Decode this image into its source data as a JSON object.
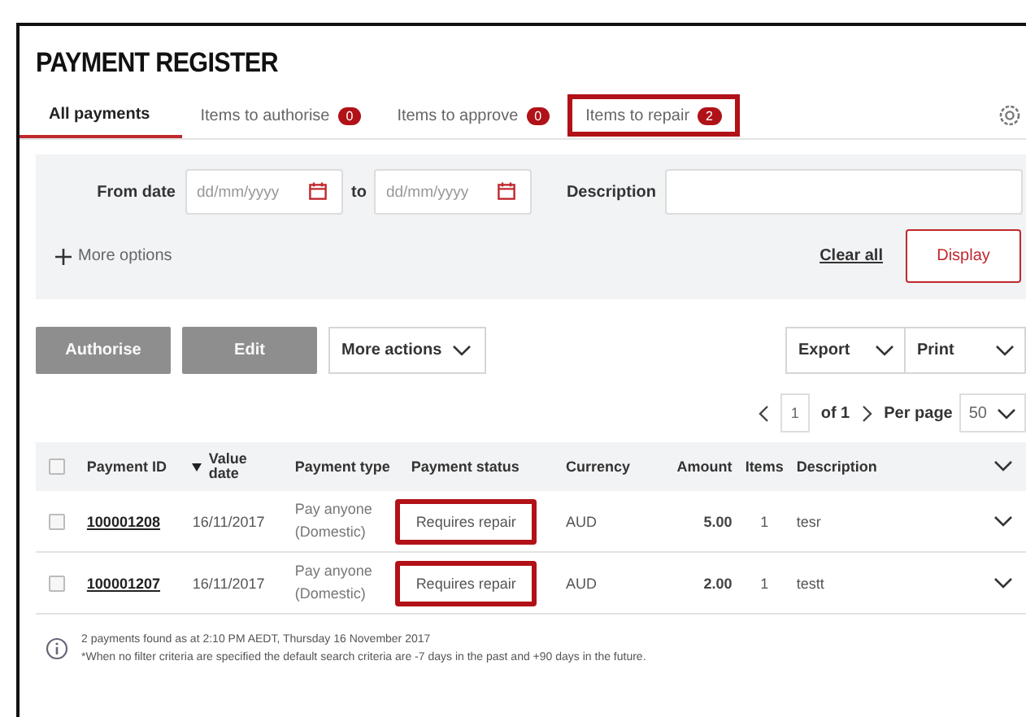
{
  "title": "PAYMENT REGISTER",
  "tabs": [
    {
      "label": "All payments",
      "selected": true,
      "highlighted": false
    },
    {
      "label": "Items to authorise",
      "count": "0",
      "selected": false,
      "highlighted": false
    },
    {
      "label": "Items to approve",
      "count": "0",
      "selected": false,
      "highlighted": false
    },
    {
      "label": "Items to repair",
      "count": "2",
      "selected": false,
      "highlighted": true
    }
  ],
  "filters": {
    "from_label": "From date",
    "from_placeholder": "dd/mm/yyyy",
    "to_label": "to",
    "to_placeholder": "dd/mm/yyyy",
    "description_label": "Description",
    "more_options": "More options",
    "clear_all": "Clear all",
    "display": "Display"
  },
  "actions": [
    {
      "kind": "button",
      "label": "Authorise",
      "disabled": true
    },
    {
      "kind": "button",
      "label": "Edit",
      "disabled": true
    },
    {
      "kind": "menu",
      "label": "More actions"
    }
  ],
  "outputs": [
    {
      "label": "Export"
    },
    {
      "label": "Print"
    }
  ],
  "pagination": {
    "page": "1",
    "of": "of 1",
    "per_page_label": "Per page",
    "per_page": "50"
  },
  "table": {
    "select_all_checked": false,
    "columns": [
      {
        "label": "Payment ID",
        "sorted": false
      },
      {
        "label": "Value date",
        "sorted": true
      },
      {
        "label": "Payment type",
        "sorted": false
      },
      {
        "label": "Payment status",
        "sorted": false
      },
      {
        "label": "Currency",
        "sorted": false
      },
      {
        "label": "Amount",
        "sorted": false
      },
      {
        "label": "Items",
        "sorted": false
      },
      {
        "label": "Description",
        "sorted": false
      }
    ],
    "rows": [
      {
        "checked": false,
        "payment_id": "100001208",
        "value_date": "16/11/2017",
        "payment_type": "Pay anyone (Domestic)",
        "status": "Requires repair",
        "status_highlighted": true,
        "currency": "AUD",
        "amount": "5.00",
        "items": "1",
        "description": "tesr"
      },
      {
        "checked": false,
        "payment_id": "100001207",
        "value_date": "16/11/2017",
        "payment_type": "Pay anyone (Domestic)",
        "status": "Requires repair",
        "status_highlighted": true,
        "currency": "AUD",
        "amount": "2.00",
        "items": "1",
        "description": "testt"
      }
    ]
  },
  "footer": [
    "2 payments found as at 2:10 PM AEDT, Thursday 16 November 2017",
    "*When no filter criteria are specified the default search criteria are -7 days in the past and +90 days in the future."
  ]
}
